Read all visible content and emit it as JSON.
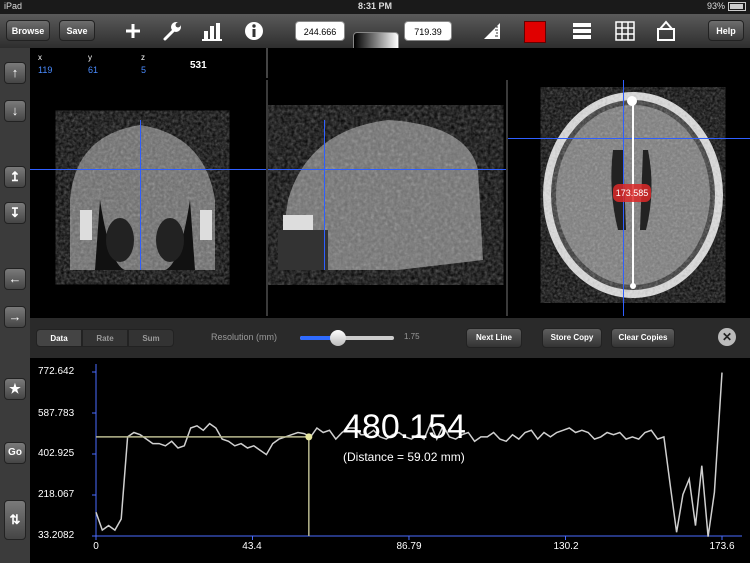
{
  "status_bar": {
    "device": "iPad",
    "time": "8:31 PM",
    "battery": "93%"
  },
  "toolbar": {
    "browse_label": "Browse",
    "save_label": "Save",
    "window_min": "244.666",
    "window_max": "719.39",
    "help_label": "Help",
    "icons": [
      "plus-icon",
      "wrench-icon",
      "bar-chart-icon",
      "info-icon",
      "ruler-icon",
      "color-square-icon",
      "layout-rows-icon",
      "grid-icon",
      "upload-icon"
    ],
    "accent": "#e00000"
  },
  "coords": {
    "x_label": "x",
    "y_label": "y",
    "z_label": "z",
    "x": "119",
    "y": "61",
    "z": "5",
    "value": "531"
  },
  "views": {
    "axial_measure": "173.585"
  },
  "left_toolbar": {
    "go_label": "Go"
  },
  "graph_toolbar": {
    "tabs": [
      "Data",
      "Rate",
      "Sum"
    ],
    "active_tab": "Data",
    "resolution_label": "Resolution (mm)",
    "resolution_value": "1.75",
    "resolution_fraction": 0.4,
    "next_line_label": "Next Line",
    "store_copy_label": "Store Copy",
    "clear_copies_label": "Clear Copies"
  },
  "readout": {
    "value": "480.154",
    "distance": "(Distance = 59.02 mm)"
  },
  "chart_data": {
    "type": "line",
    "xlim": [
      0,
      173.6
    ],
    "ylim": [
      33.2082,
      772.642
    ],
    "y_ticks": [
      "772.642",
      "587.783",
      "402.925",
      "218.067",
      "33.2082"
    ],
    "x_ticks": [
      "0",
      "43.4",
      "86.79",
      "130.2",
      "173.6"
    ],
    "cursor": {
      "x": 59.02,
      "y": 480.154
    },
    "x": [
      0,
      1.75,
      3.5,
      5.25,
      7,
      8.75,
      10.5,
      12.25,
      14,
      15.75,
      17.5,
      19.25,
      21,
      22.75,
      24.5,
      26.25,
      28,
      29.75,
      31.5,
      33.25,
      35,
      36.75,
      38.5,
      40.25,
      42,
      43.75,
      45.5,
      47.25,
      49,
      50.75,
      52.5,
      54.25,
      56,
      57.75,
      59.5,
      61.25,
      63,
      64.75,
      66.5,
      68.25,
      70,
      71.75,
      73.5,
      75.25,
      77,
      78.75,
      80.5,
      82.25,
      84,
      85.75,
      87.5,
      89.25,
      91,
      92.75,
      94.5,
      96.25,
      98,
      99.75,
      101.5,
      103.25,
      105,
      106.75,
      108.5,
      110.25,
      112,
      113.75,
      115.5,
      117.25,
      119,
      120.75,
      122.5,
      124.25,
      126,
      127.75,
      129.5,
      131.25,
      133,
      134.75,
      136.5,
      138.25,
      140,
      141.75,
      143.5,
      145.25,
      147,
      148.75,
      150.5,
      152.25,
      154,
      155.75,
      157.5,
      159.25,
      161,
      162.75,
      164.5,
      166.25,
      168,
      169.75,
      171.5,
      173.6
    ],
    "values": [
      140,
      60,
      80,
      60,
      110,
      480,
      500,
      490,
      470,
      450,
      450,
      440,
      460,
      430,
      440,
      520,
      530,
      510,
      540,
      520,
      470,
      460,
      440,
      450,
      430,
      440,
      420,
      400,
      450,
      470,
      480,
      490,
      500,
      495,
      480,
      520,
      500,
      510,
      470,
      500,
      520,
      520,
      490,
      490,
      510,
      480,
      470,
      490,
      500,
      480,
      470,
      490,
      470,
      540,
      470,
      530,
      480,
      470,
      490,
      500,
      460,
      480,
      480,
      500,
      470,
      460,
      490,
      470,
      500,
      510,
      470,
      500,
      480,
      500,
      510,
      520,
      500,
      510,
      500,
      470,
      480,
      500,
      490,
      500,
      470,
      480,
      470,
      500,
      510,
      470,
      480,
      260,
      50,
      220,
      290,
      80,
      350,
      30,
      230,
      770,
      620,
      420
    ]
  }
}
